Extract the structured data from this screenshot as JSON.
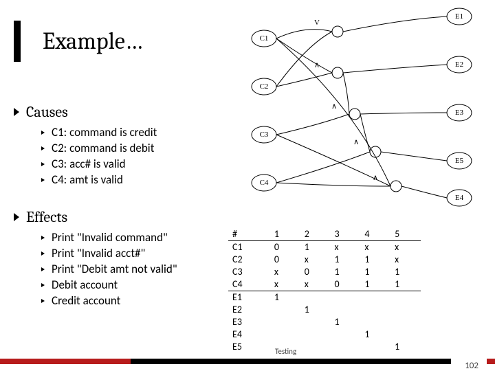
{
  "title": "Example…",
  "causes": {
    "header": "Causes",
    "items": [
      "C1: command is credit",
      "C2: command is debit",
      "C3: acc# is valid",
      "C4: amt is valid"
    ]
  },
  "effects": {
    "header": "Effects",
    "items": [
      "Print \"Invalid command\"",
      "Print \"Invalid acct#\"",
      "Print \"Debit amt not valid\"",
      "Debit account",
      "Credit account"
    ]
  },
  "table": {
    "headers": [
      "#",
      "1",
      "2",
      "3",
      "4",
      "5"
    ],
    "rows": [
      [
        "C1",
        "0",
        "1",
        "x",
        "x",
        "x"
      ],
      [
        "C2",
        "0",
        "x",
        "1",
        "1",
        "x"
      ],
      [
        "C3",
        "x",
        "0",
        "1",
        "1",
        "1"
      ],
      [
        "C4",
        "x",
        "x",
        "0",
        "1",
        "1"
      ],
      [
        "E1",
        "1",
        "",
        "",
        "",
        ""
      ],
      [
        "E2",
        "",
        "1",
        "",
        "",
        ""
      ],
      [
        "E3",
        "",
        "",
        "1",
        "",
        ""
      ],
      [
        "E4",
        "",
        "",
        "",
        "1",
        ""
      ],
      [
        "E5",
        "",
        "",
        "",
        "",
        "1"
      ]
    ],
    "split_after_row_index": 3
  },
  "footer": {
    "label": "Testing",
    "page": "102"
  },
  "diagram": {
    "causes": [
      "C1",
      "C2",
      "C3",
      "C4"
    ],
    "effects": [
      "E1",
      "E2",
      "E3",
      "E4",
      "E5"
    ],
    "operators": [
      "V",
      "∧",
      "∧",
      "∧",
      "∧"
    ]
  }
}
